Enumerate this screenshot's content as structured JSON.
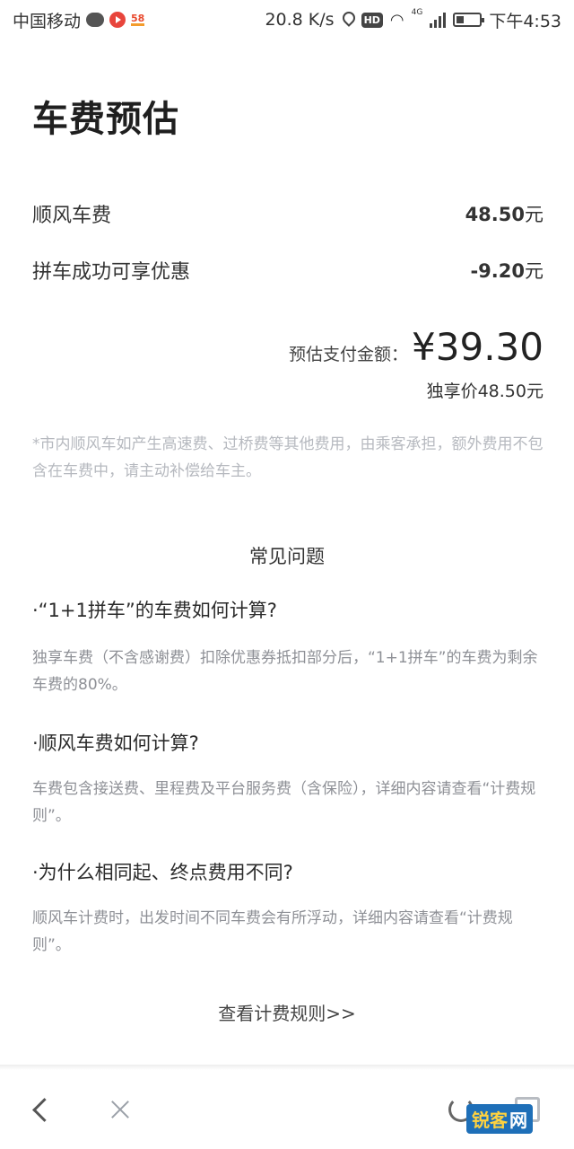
{
  "status_bar": {
    "carrier": "中国移动",
    "app_badge": "58",
    "net_speed": "20.8 K/s",
    "hd": "HD",
    "net_type": "4G",
    "time": "下午4:53"
  },
  "page": {
    "title": "车费预估"
  },
  "fees": {
    "ride_fee_label": "顺风车费",
    "ride_fee_value": "48.50",
    "ride_fee_unit": "元",
    "discount_label": "拼车成功可享优惠",
    "discount_value": "-9.20",
    "discount_unit": "元"
  },
  "total": {
    "label": "预估支付金额：",
    "amount": "¥39.30",
    "exclusive_price": "独享价48.50元"
  },
  "notice": "*市内顺风车如产生高速费、过桥费等其他费用，由乘客承担，额外费用不包含在车费中，请主动补偿给车主。",
  "faq": {
    "title": "常见问题",
    "items": [
      {
        "question": "·“1+1拼车”的车费如何计算?",
        "answer": "独享车费（不含感谢费）扣除优惠券抵扣部分后，“1+1拼车”的车费为剩余车费的80%。"
      },
      {
        "question": "·顺风车费如何计算?",
        "answer": "车费包含接送费、里程费及平台服务费（含保险），详细内容请查看“计费规则”。"
      },
      {
        "question": "·为什么相同起、终点费用不同?",
        "answer": "顺风车计费时，出发时间不同车费会有所浮动，详细内容请查看“计费规则”。"
      }
    ]
  },
  "rules_link": "查看计费规则>>",
  "watermark": {
    "text1": "锐客",
    "text2": "网"
  },
  "icons": {
    "back": "back-icon",
    "close": "close-icon",
    "refresh": "refresh-icon",
    "expand": "expand-icon"
  }
}
